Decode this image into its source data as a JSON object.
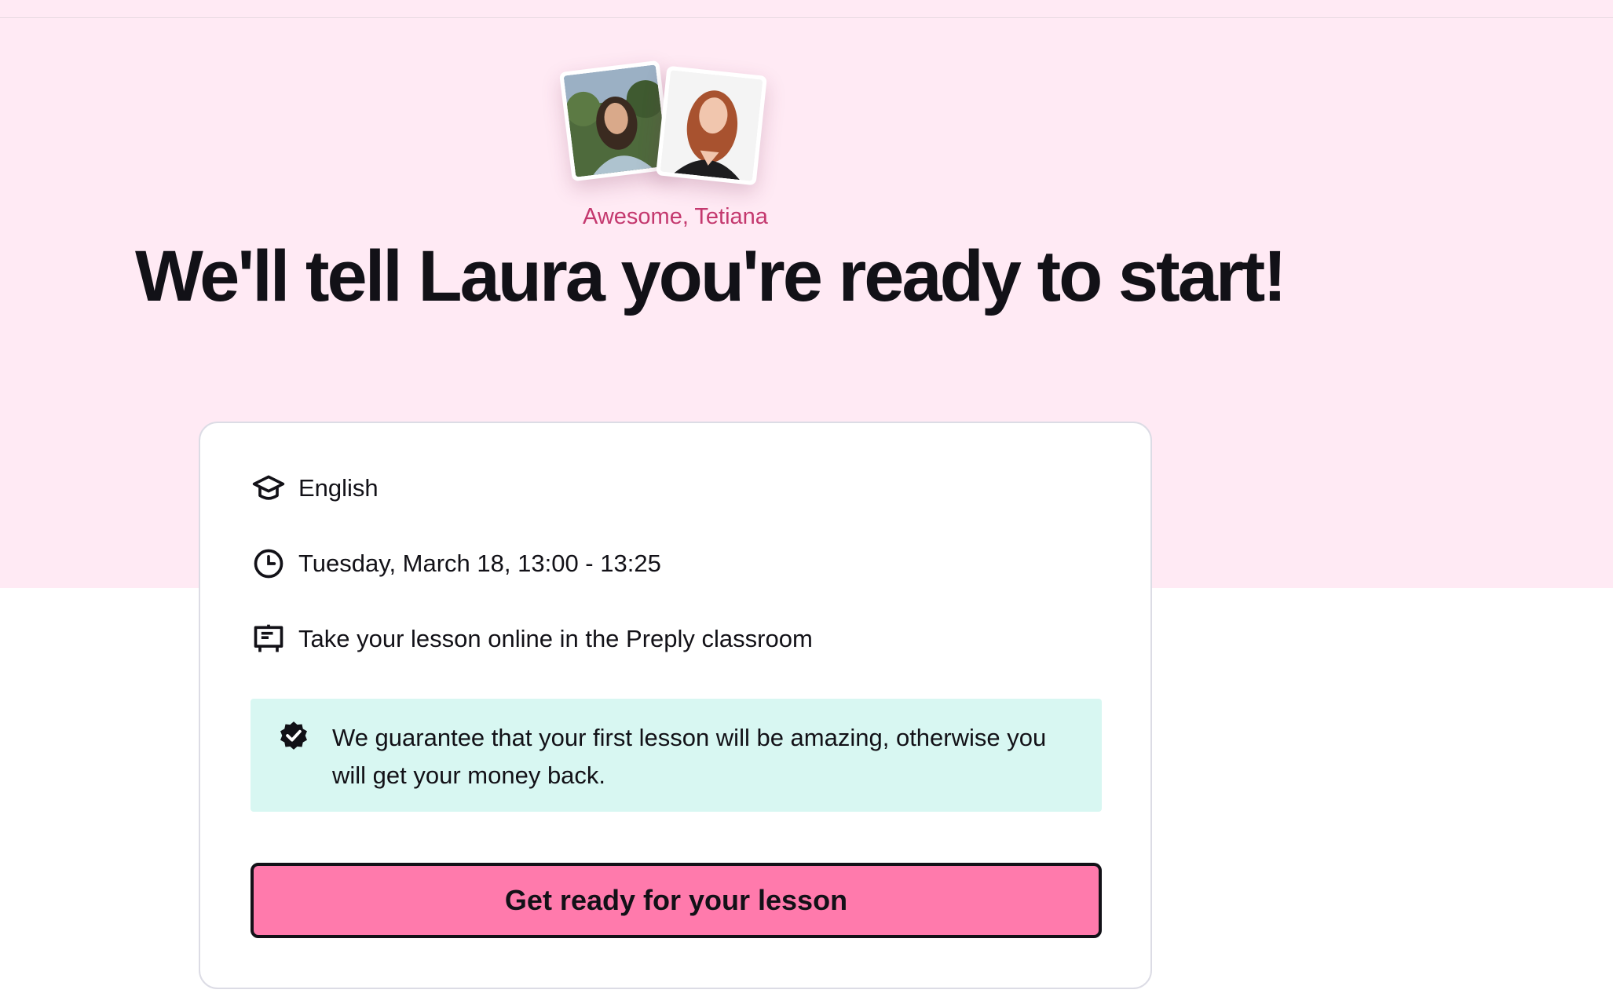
{
  "hero": {
    "greeting": "Awesome, Tetiana",
    "headline": "We'll tell Laura you're ready to start!",
    "background_color": "#ffeaf4",
    "greeting_color": "#c4386e"
  },
  "avatars": [
    {
      "name": "student-photo",
      "icon": "user-photo"
    },
    {
      "name": "tutor-photo",
      "icon": "user-photo"
    }
  ],
  "lesson": {
    "subject": "English",
    "subject_icon": "graduation-cap-icon",
    "time": "Tuesday, March 18, 13:00 - 13:25",
    "time_icon": "clock-icon",
    "location": "Take your lesson online in the Preply classroom",
    "location_icon": "classroom-board-icon"
  },
  "guarantee": {
    "text": "We guarantee that your first lesson will be amazing, otherwise you will get your money back.",
    "icon": "verified-badge-icon",
    "background_color": "#d8f7f2"
  },
  "cta": {
    "label": "Get ready for your lesson",
    "background_color": "#ff7aac"
  }
}
